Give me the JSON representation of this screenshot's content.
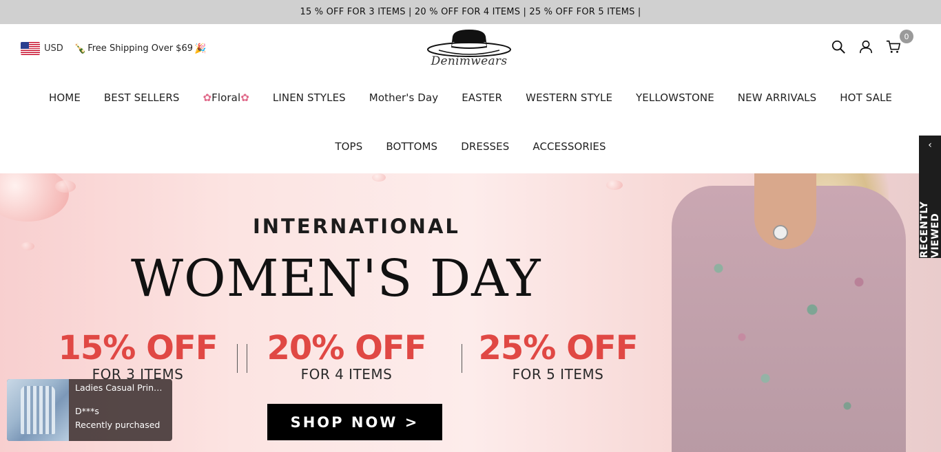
{
  "announcement": "15 % OFF FOR 3 ITEMS | 20 % OFF FOR 4 ITEMS | 25 % OFF FOR 5 ITEMS |",
  "header": {
    "currency": "USD",
    "shipping": "Free Shipping Over $69",
    "logo_text": "Denimwears",
    "cart_count": "0"
  },
  "nav": {
    "row1": [
      "HOME",
      "BEST SELLERS",
      "Floral",
      "LINEN STYLES",
      "Mother's Day",
      "EASTER",
      "WESTERN STYLE",
      "YELLOWSTONE",
      "NEW ARRIVALS",
      "HOT SALE"
    ],
    "row2": [
      "TOPS",
      "BOTTOMS",
      "DRESSES",
      "ACCESSORIES"
    ]
  },
  "hero": {
    "line1": "INTERNATIONAL",
    "line2": "WOMEN'S DAY",
    "offers": [
      {
        "pct": "15% OFF",
        "qty": "FOR 3 ITEMS"
      },
      {
        "pct": "20% OFF",
        "qty": "FOR 4 ITEMS"
      },
      {
        "pct": "25% OFF",
        "qty": "FOR 5 ITEMS"
      }
    ],
    "button": "SHOP NOW >"
  },
  "recently_viewed": "RECENTLY VIEWED",
  "popup": {
    "title": "Ladies Casual Print ...",
    "user": "D***s",
    "status": "Recently purchased"
  },
  "colors": {
    "announcement_bg": "#d0d0d0",
    "offer_red": "#e04844",
    "button_bg": "#000000",
    "tab_bg": "#1d1d1d"
  },
  "icons": [
    "us-flag-icon",
    "bottle-icon",
    "party-popper-icon",
    "search-icon",
    "user-icon",
    "cart-icon",
    "flower-icon",
    "chevron-left-icon"
  ]
}
